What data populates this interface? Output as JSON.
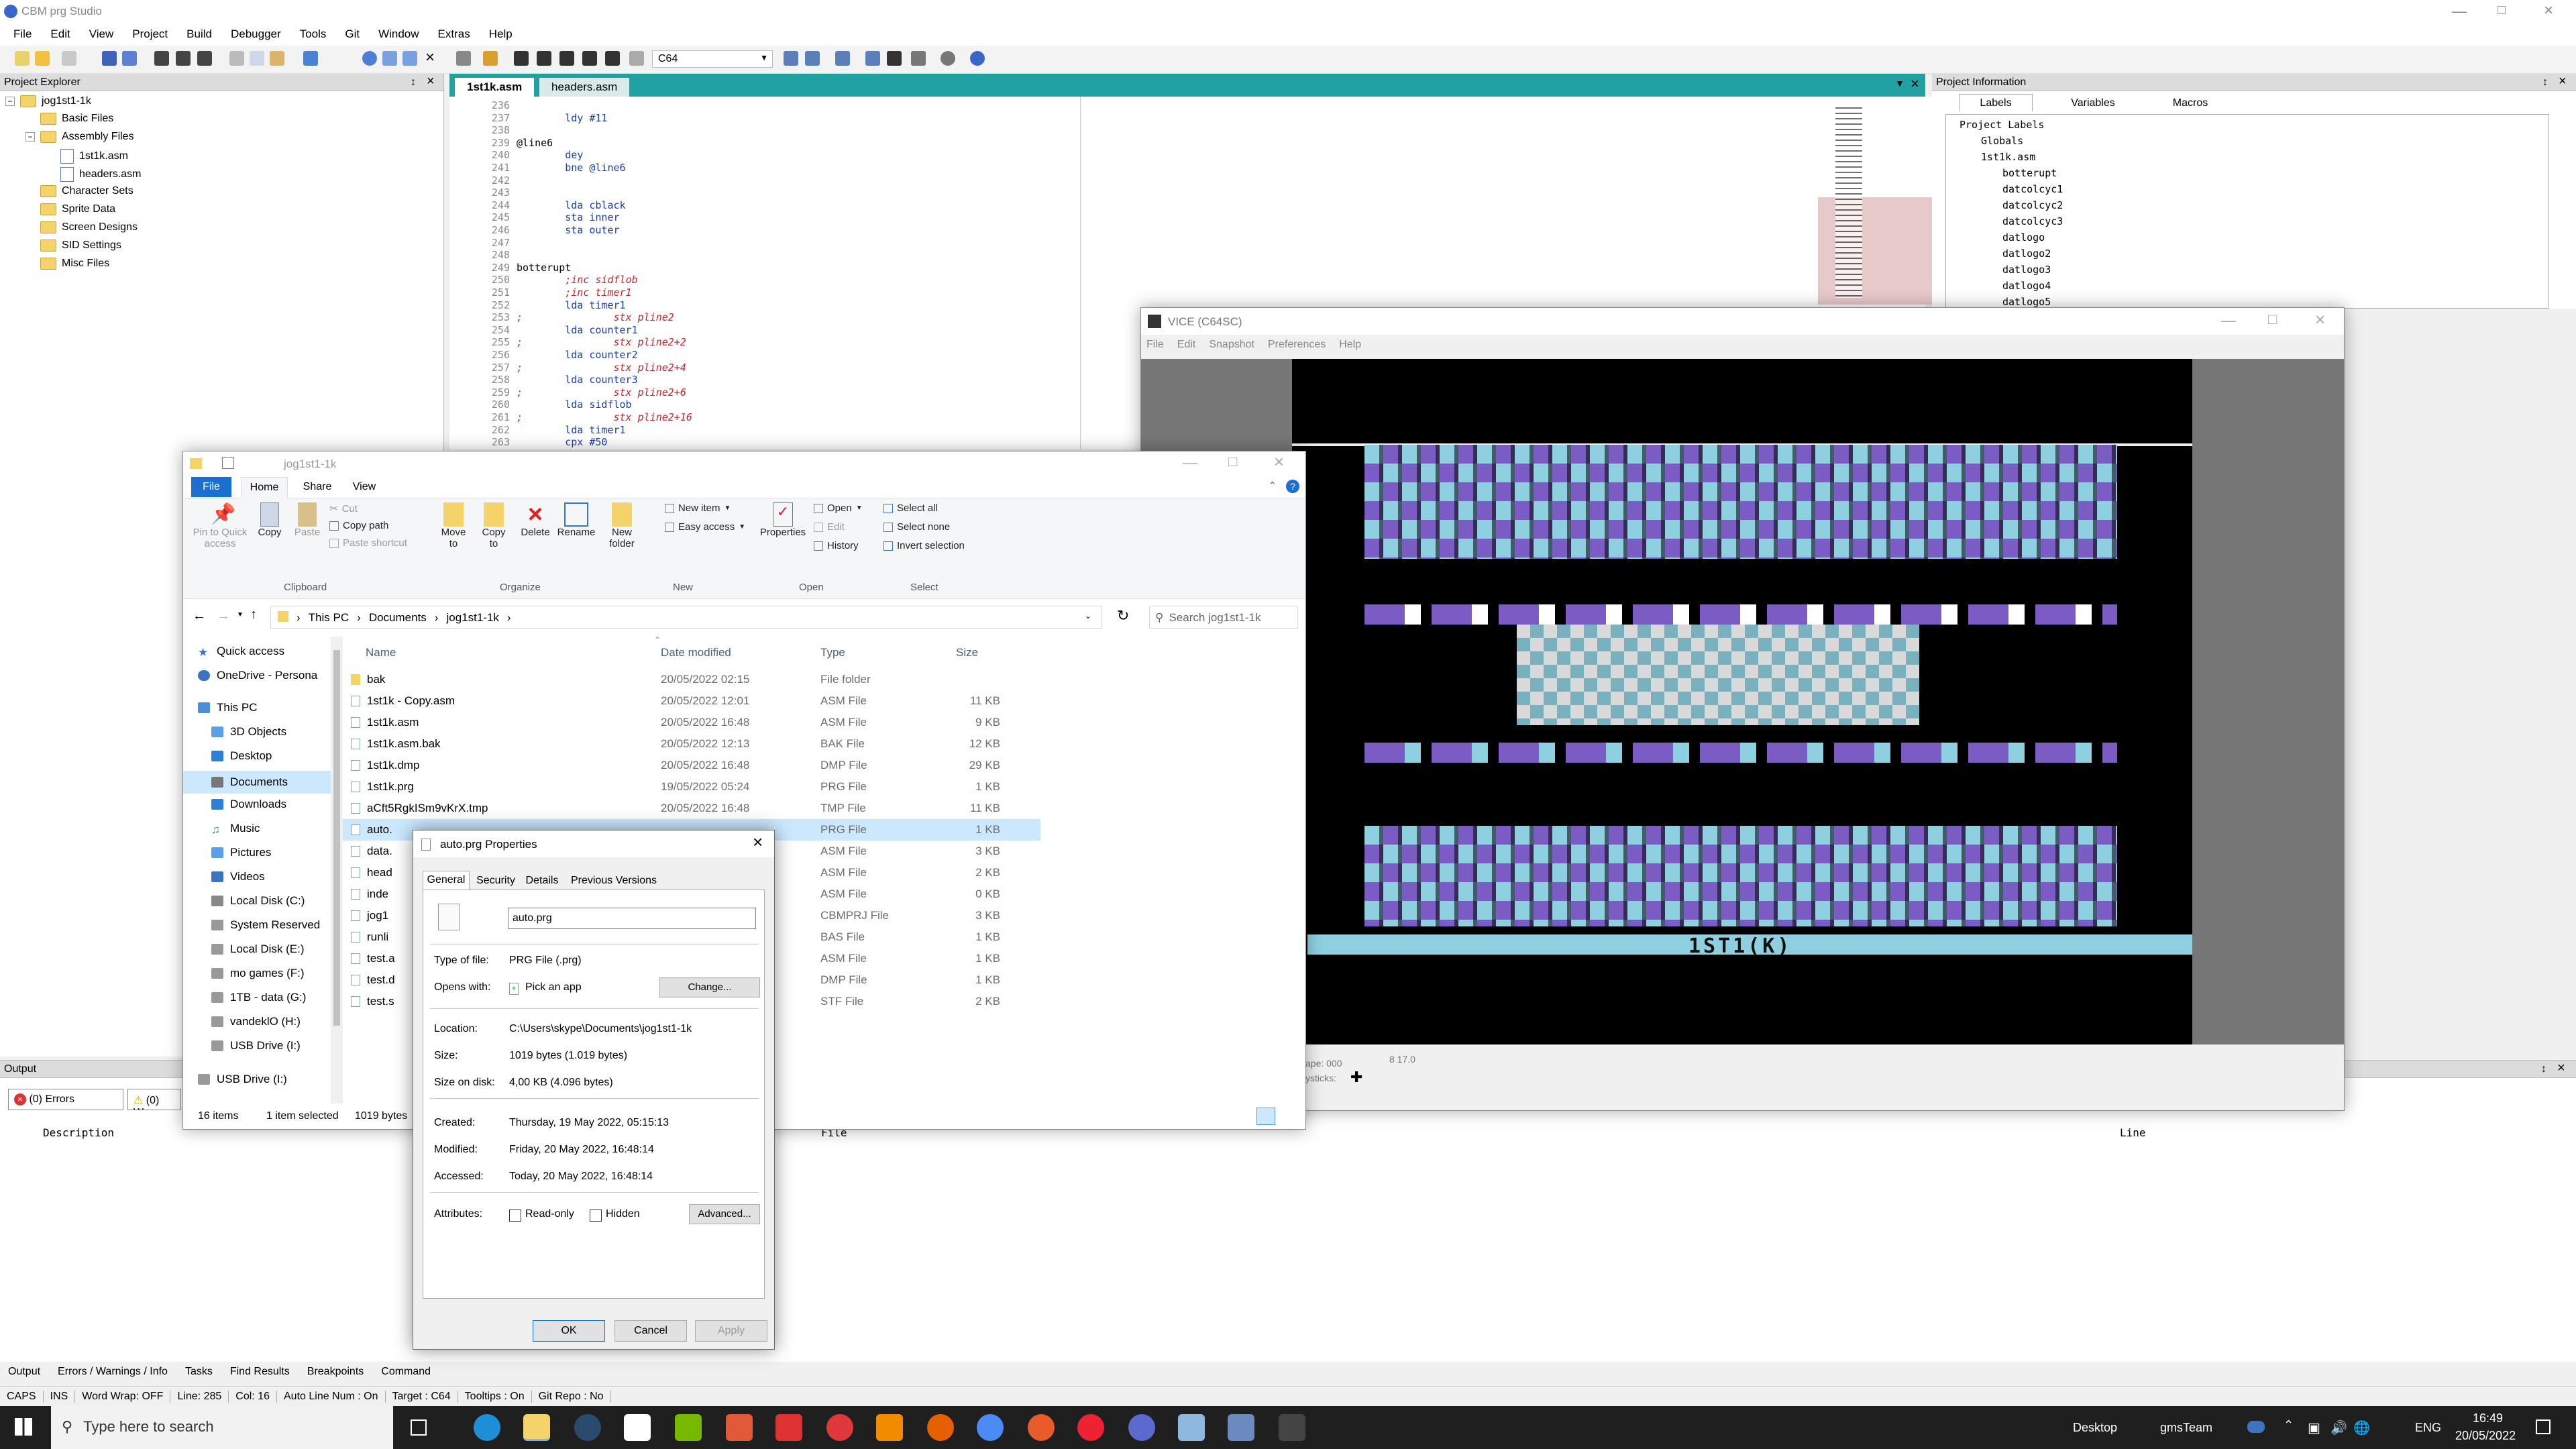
{
  "app": {
    "title": "CBM prg Studio",
    "menu": [
      "File",
      "Edit",
      "View",
      "Project",
      "Build",
      "Debugger",
      "Tools",
      "Git",
      "Window",
      "Extras",
      "Help"
    ],
    "target_combo": "C64"
  },
  "project_explorer": {
    "title": "Project Explorer",
    "root": "jog1st1-1k",
    "items": [
      "Basic Files",
      "Assembly Files",
      "1st1k.asm",
      "headers.asm",
      "Character Sets",
      "Sprite Data",
      "Screen Designs",
      "SID Settings",
      "Misc Files"
    ]
  },
  "editor": {
    "tabs": [
      "1st1k.asm",
      "headers.asm"
    ],
    "lines": [
      {
        "n": "236",
        "t": "",
        "c": ""
      },
      {
        "n": "237",
        "t": "        ldy #11",
        "c": "code"
      },
      {
        "n": "238",
        "t": "",
        "c": ""
      },
      {
        "n": "239",
        "t": "@line6",
        "c": "label"
      },
      {
        "n": "240",
        "t": "        dey",
        "c": "code"
      },
      {
        "n": "241",
        "t": "        bne @line6",
        "c": "code"
      },
      {
        "n": "242",
        "t": "",
        "c": ""
      },
      {
        "n": "243",
        "t": "",
        "c": ""
      },
      {
        "n": "244",
        "t": "        lda cblack",
        "c": "code"
      },
      {
        "n": "245",
        "t": "        sta inner",
        "c": "code"
      },
      {
        "n": "246",
        "t": "        sta outer",
        "c": "code"
      },
      {
        "n": "247",
        "t": "",
        "c": ""
      },
      {
        "n": "248",
        "t": "",
        "c": ""
      },
      {
        "n": "249",
        "t": "botterupt",
        "c": "label"
      },
      {
        "n": "250",
        "t": "        ;inc sidflob",
        "c": "comment"
      },
      {
        "n": "251",
        "t": "        ;inc timer1",
        "c": "comment"
      },
      {
        "n": "252",
        "t": "        lda timer1",
        "c": "code"
      },
      {
        "n": "253",
        "t": ";               stx pline2",
        "c": "comment"
      },
      {
        "n": "254",
        "t": "        lda counter1",
        "c": "code"
      },
      {
        "n": "255",
        "t": ";               stx pline2+2",
        "c": "comment"
      },
      {
        "n": "256",
        "t": "        lda counter2",
        "c": "code"
      },
      {
        "n": "257",
        "t": ";               stx pline2+4",
        "c": "comment"
      },
      {
        "n": "258",
        "t": "        lda counter3",
        "c": "code"
      },
      {
        "n": "259",
        "t": ";               stx pline2+6",
        "c": "comment"
      },
      {
        "n": "260",
        "t": "        lda sidflob",
        "c": "code"
      },
      {
        "n": "261",
        "t": ";               stx pline2+16",
        "c": "comment"
      },
      {
        "n": "262",
        "t": "        lda timer1",
        "c": "code"
      },
      {
        "n": "263",
        "t": "        cpx #50",
        "c": "code"
      }
    ]
  },
  "project_info": {
    "title": "Project Information",
    "tabs": [
      "Labels",
      "Variables",
      "Macros"
    ],
    "tree": [
      "Project Labels",
      "Globals",
      "1st1k.asm",
      "botterupt",
      "datcolcyc1",
      "datcolcyc2",
      "datcolcyc3",
      "datlogo",
      "datlogo2",
      "datlogo3",
      "datlogo4",
      "datlogo5"
    ]
  },
  "output": {
    "title": "Output",
    "errors_btn": "(0) Errors",
    "warn_btn": "(0) Wa",
    "columns": [
      "Description",
      "File",
      "Line"
    ]
  },
  "bottom_tabs": [
    "Output",
    "Errors / Warnings / Info",
    "Tasks",
    "Find Results",
    "Breakpoints",
    "Command"
  ],
  "status": [
    "CAPS",
    "INS",
    "Word Wrap: OFF",
    "Line: 285",
    "Col: 16",
    "Auto Line Num : On",
    "Target : C64",
    "Tooltips : On",
    "Git Repo : No"
  ],
  "vice": {
    "title": "VICE (C64SC)",
    "menu": [
      "File",
      "Edit",
      "Snapshot",
      "Preferences",
      "Help"
    ],
    "screen_text": "1ST1(K)",
    "status_left": "ape: 000",
    "status_right": "8 17.0",
    "joy": "ysticks:"
  },
  "file_explorer": {
    "title": "jog1st1-1k",
    "ribbon_tabs": [
      "File",
      "Home",
      "Share",
      "View"
    ],
    "clipboard": {
      "pin": "Pin to Quick access",
      "copy": "Copy",
      "paste": "Paste",
      "cut": "Cut",
      "copy_path": "Copy path",
      "paste_shortcut": "Paste shortcut",
      "group": "Clipboard"
    },
    "organize": {
      "move": "Move to",
      "copy": "Copy to",
      "delete": "Delete",
      "rename": "Rename",
      "group": "Organize"
    },
    "new": {
      "folder": "New folder",
      "item": "New item",
      "easy": "Easy access",
      "group": "New"
    },
    "open": {
      "props": "Properties",
      "open": "Open",
      "edit": "Edit",
      "history": "History",
      "group": "Open"
    },
    "select": {
      "all": "Select all",
      "none": "Select none",
      "invert": "Invert selection",
      "group": "Select"
    },
    "path": [
      "This PC",
      "Documents",
      "jog1st1-1k"
    ],
    "search_placeholder": "Search jog1st1-1k",
    "nav": [
      "Quick access",
      "OneDrive - Persona",
      "This PC",
      "3D Objects",
      "Desktop",
      "Documents",
      "Downloads",
      "Music",
      "Pictures",
      "Videos",
      "Local Disk (C:)",
      "System Reserved",
      "Local Disk (E:)",
      "mo games (F:)",
      "1TB - data (G:)",
      "vandeklO (H:)",
      "USB Drive (I:)",
      "USB Drive (I:)"
    ],
    "columns": [
      "Name",
      "Date modified",
      "Type",
      "Size"
    ],
    "files": [
      {
        "name": "bak",
        "date": "20/05/2022 02:15",
        "type": "File folder",
        "size": ""
      },
      {
        "name": "1st1k - Copy.asm",
        "date": "20/05/2022 12:01",
        "type": "ASM File",
        "size": "11 KB"
      },
      {
        "name": "1st1k.asm",
        "date": "20/05/2022 16:48",
        "type": "ASM File",
        "size": "9 KB"
      },
      {
        "name": "1st1k.asm.bak",
        "date": "20/05/2022 12:13",
        "type": "BAK File",
        "size": "12 KB"
      },
      {
        "name": "1st1k.dmp",
        "date": "20/05/2022 16:48",
        "type": "DMP File",
        "size": "29 KB"
      },
      {
        "name": "1st1k.prg",
        "date": "19/05/2022 05:24",
        "type": "PRG File",
        "size": "1 KB"
      },
      {
        "name": "aCft5RgkISm9vKrX.tmp",
        "date": "20/05/2022 16:48",
        "type": "TMP File",
        "size": "11 KB"
      },
      {
        "name": "auto.",
        "date": "",
        "type": "PRG File",
        "size": "1 KB"
      },
      {
        "name": "data.",
        "date": "",
        "type": "ASM File",
        "size": "3 KB"
      },
      {
        "name": "head",
        "date": "",
        "type": "ASM File",
        "size": "2 KB"
      },
      {
        "name": "inde",
        "date": "",
        "type": "ASM File",
        "size": "0 KB"
      },
      {
        "name": "jog1",
        "date": "",
        "type": "CBMPRJ File",
        "size": "3 KB"
      },
      {
        "name": "runli",
        "date": "",
        "type": "BAS File",
        "size": "1 KB"
      },
      {
        "name": "test.a",
        "date": "",
        "type": "ASM File",
        "size": "1 KB"
      },
      {
        "name": "test.d",
        "date": "",
        "type": "DMP File",
        "size": "1 KB"
      },
      {
        "name": "test.s",
        "date": "",
        "type": "STF File",
        "size": "2 KB"
      }
    ],
    "status_items": "16 items",
    "status_selected": "1 item selected",
    "status_size": "1019 bytes"
  },
  "properties": {
    "title": "auto.prg Properties",
    "tabs": [
      "General",
      "Security",
      "Details",
      "Previous Versions"
    ],
    "filename": "auto.prg",
    "type_label": "Type of file:",
    "type_value": "PRG File (.prg)",
    "opens_label": "Opens with:",
    "opens_value": "Pick an app",
    "change": "Change...",
    "location_label": "Location:",
    "location_value": "C:\\Users\\skype\\Documents\\jog1st1-1k",
    "size_label": "Size:",
    "size_value": "1019 bytes (1.019 bytes)",
    "disk_label": "Size on disk:",
    "disk_value": "4,00 KB (4.096 bytes)",
    "created_label": "Created:",
    "created_value": "Thursday, 19 May 2022, 05:15:13",
    "modified_label": "Modified:",
    "modified_value": "Friday, 20 May 2022, 16:48:14",
    "accessed_label": "Accessed:",
    "accessed_value": "Today, 20 May 2022, 16:48:14",
    "attr_label": "Attributes:",
    "readonly": "Read-only",
    "hidden": "Hidden",
    "advanced": "Advanced...",
    "ok": "OK",
    "cancel": "Cancel",
    "apply": "Apply"
  },
  "taskbar": {
    "search_placeholder": "Type here to search",
    "desktop": "Desktop",
    "user": "gmsTeam",
    "lang": "ENG",
    "time": "16:49",
    "date": "20/05/2022"
  },
  "colors": {
    "accent_teal": "#21a1a1",
    "c64_purple": "#7b5bc4",
    "c64_lightblue": "#8fd0e0",
    "c64_white": "#ffffff",
    "c64_black": "#000000",
    "c64_gray": "#777777"
  }
}
